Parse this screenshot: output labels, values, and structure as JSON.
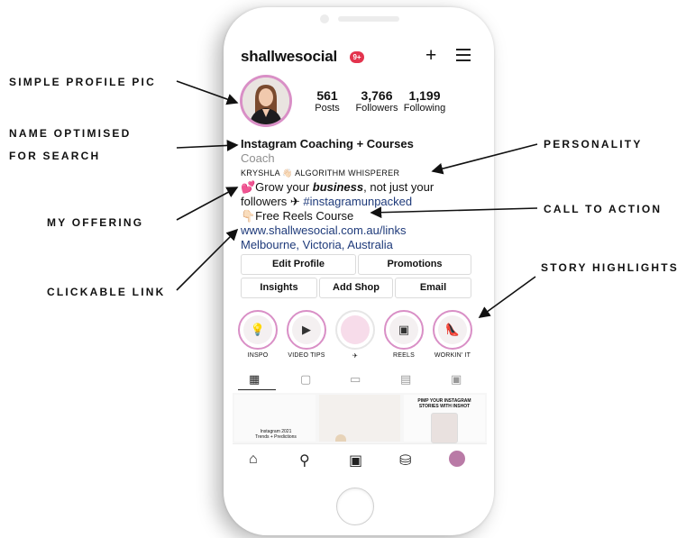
{
  "profile": {
    "username": "shallwesocial",
    "notification_count": "9+",
    "stats": [
      {
        "value": "561",
        "label": "Posts"
      },
      {
        "value": "3,766",
        "label": "Followers"
      },
      {
        "value": "1,199",
        "label": "Following"
      }
    ],
    "bio": {
      "name": "Instagram Coaching + Courses",
      "category": "Coach",
      "line1": "KRYSHLA 👋🏻 ALGORITHM WHISPERER",
      "line2_prefix": "💕Grow your ",
      "line2_emph": "business",
      "line2_suffix": ", not just your",
      "line3_text": "followers ✈ ",
      "line3_hashtag": "#instagramunpacked",
      "line4": "👇🏻Free Reels Course",
      "link": "www.shallwesocial.com.au/links",
      "location": "Melbourne, Victoria, Australia"
    },
    "buttons": {
      "edit_profile": "Edit Profile",
      "promotions": "Promotions",
      "insights": "Insights",
      "add_shop": "Add Shop",
      "email": "Email"
    },
    "highlights": [
      {
        "label": "INSPO",
        "icon": "lightbulb-icon"
      },
      {
        "label": "VIDEO TIPS",
        "icon": "play-icon"
      },
      {
        "label": "✈",
        "icon": "instagram-unpacked-cover"
      },
      {
        "label": "REELS",
        "icon": "reels-icon"
      },
      {
        "label": "WORKIN' IT",
        "icon": "high-heel-icon"
      }
    ],
    "grid_text": {
      "post1": "Instagram 2021 Trends + Predictions",
      "post3": "PIMP YOUR INSTAGRAM STORIES WITH INSHOT"
    }
  },
  "annotations": {
    "simple_profile_pic": "SIMPLE PROFILE PIC",
    "name_optimised_line1": "NAME OPTIMISED",
    "name_optimised_line2": "FOR SEARCH",
    "my_offering": "MY OFFERING",
    "clickable_link": "CLICKABLE LINK",
    "personality": "PERSONALITY",
    "call_to_action": "CALL TO ACTION",
    "story_highlights": "STORY HIGHLIGHTS"
  },
  "colors": {
    "accent_pink": "#d98fc6",
    "badge_red": "#e3344e",
    "link_blue": "#1e3a7a"
  }
}
